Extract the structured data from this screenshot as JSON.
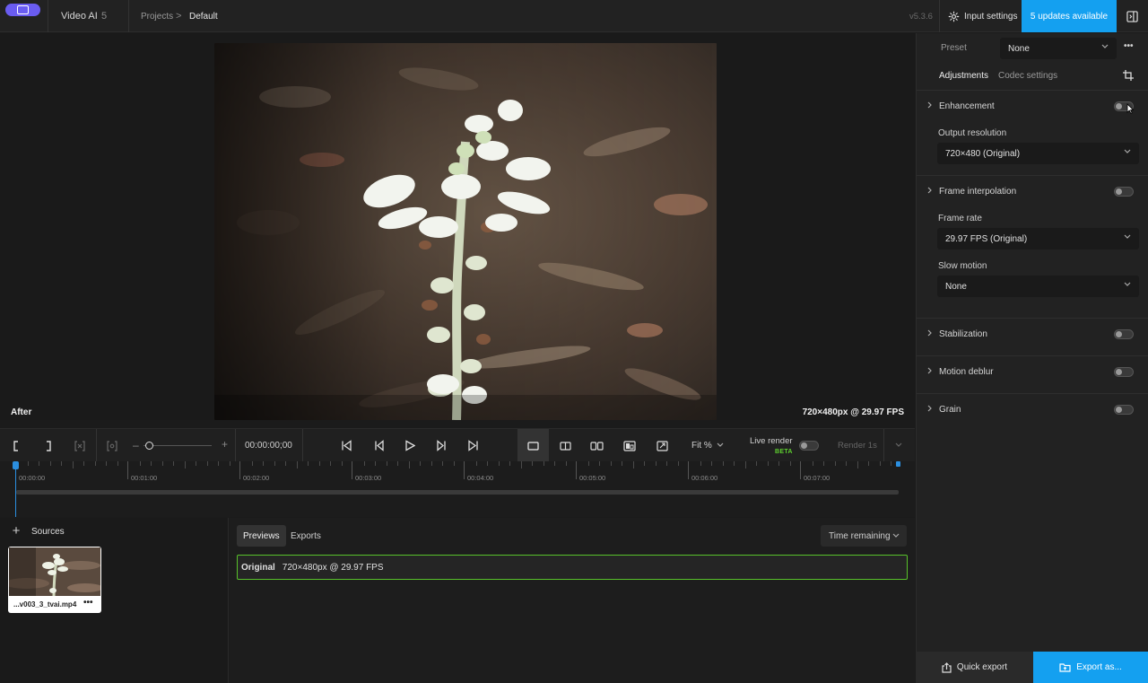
{
  "app": {
    "name": "Video AI",
    "version_badge": "5",
    "build": "v5.3.6"
  },
  "breadcrumb": {
    "projects": "Projects",
    "separator": ">",
    "current": "Default"
  },
  "header": {
    "input_settings": "Input settings",
    "updates": "5 updates available"
  },
  "preview": {
    "mode_label": "After",
    "resolution": "720×480px @ 29.97 FPS"
  },
  "transport": {
    "timecode": "00:00:00;00",
    "fit": "Fit %",
    "live_render": "Live render",
    "beta": "BETA",
    "render_1s": "Render 1s"
  },
  "timeline": {
    "ticks": [
      "00:00:00",
      "00:01:00",
      "00:02:00",
      "00:03:00",
      "00:04:00",
      "00:05:00",
      "00:06:00",
      "00:07:00"
    ]
  },
  "sources": {
    "title": "Sources",
    "add": "+",
    "file_name": "...v003_3_tvai.mp4",
    "more": "•••"
  },
  "exports": {
    "tabs": [
      "Previews",
      "Exports"
    ],
    "sort": "Time remaining",
    "row_label": "Original",
    "row_detail": "720×480px @ 29.97 FPS"
  },
  "right_panel": {
    "preset_label": "Preset",
    "preset_value": "None",
    "more": "•••",
    "tabs": [
      "Adjustments",
      "Codec settings"
    ],
    "sections": {
      "enhancement": "Enhancement",
      "output_resolution_label": "Output resolution",
      "output_resolution_value": "720×480 (Original)",
      "frame_interpolation": "Frame interpolation",
      "frame_rate_label": "Frame rate",
      "frame_rate_value": "29.97 FPS (Original)",
      "slow_motion_label": "Slow motion",
      "slow_motion_value": "None",
      "stabilization": "Stabilization",
      "motion_deblur": "Motion deblur",
      "grain": "Grain"
    },
    "quick_export": "Quick export",
    "export_as": "Export as..."
  },
  "colors": {
    "accent": "#14a0f0",
    "logo": "#6a5cf0",
    "highlight": "#58c22a",
    "beta": "#5ed12f"
  }
}
